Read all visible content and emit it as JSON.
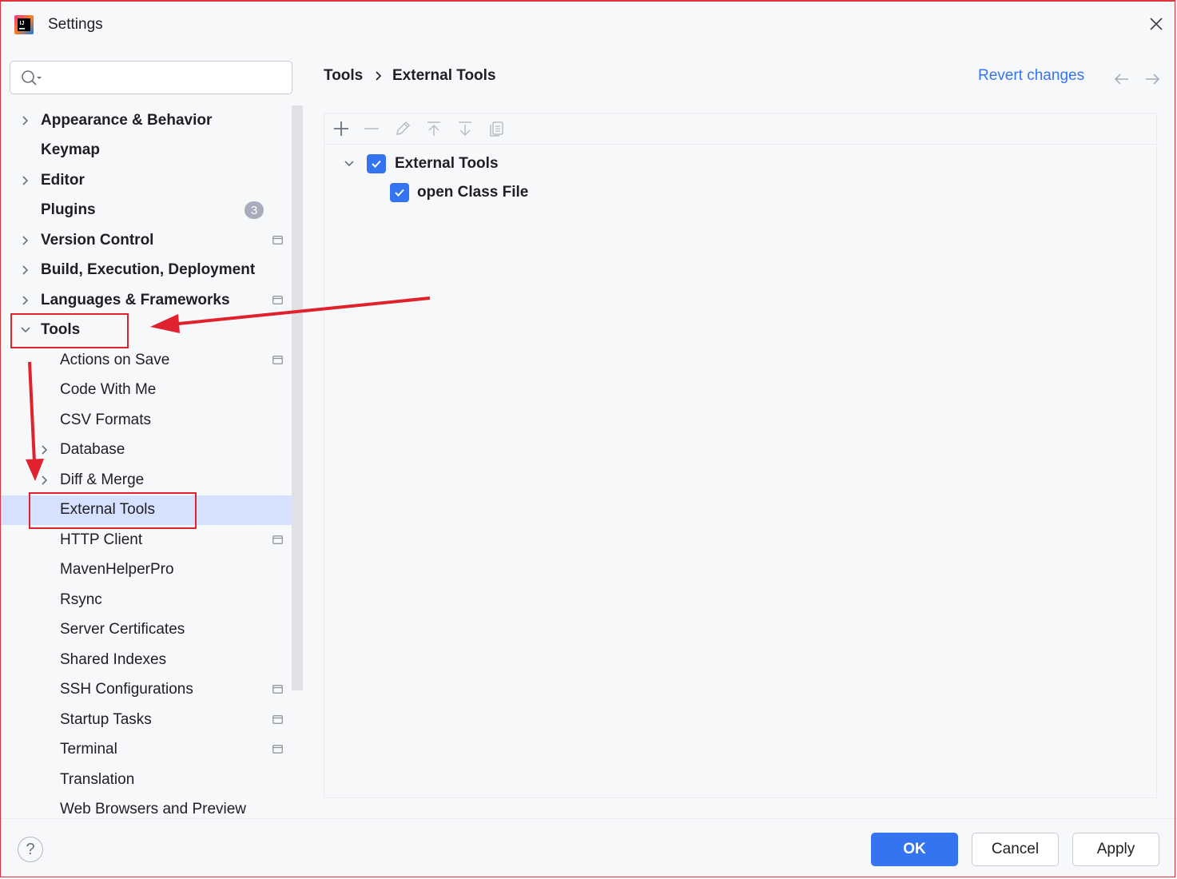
{
  "window": {
    "title": "Settings"
  },
  "search": {
    "placeholder": "",
    "value": ""
  },
  "sidebar": {
    "items": [
      {
        "label": "Appearance & Behavior",
        "level": 0,
        "bold": true,
        "expandable": true,
        "expanded": false
      },
      {
        "label": "Keymap",
        "level": 0,
        "bold": true,
        "expandable": false
      },
      {
        "label": "Editor",
        "level": 0,
        "bold": true,
        "expandable": true,
        "expanded": false
      },
      {
        "label": "Plugins",
        "level": 0,
        "bold": true,
        "expandable": false,
        "badge": "3"
      },
      {
        "label": "Version Control",
        "level": 0,
        "bold": true,
        "expandable": true,
        "expanded": false,
        "project_icon": true
      },
      {
        "label": "Build, Execution, Deployment",
        "level": 0,
        "bold": true,
        "expandable": true,
        "expanded": false
      },
      {
        "label": "Languages & Frameworks",
        "level": 0,
        "bold": true,
        "expandable": true,
        "expanded": false,
        "project_icon": true
      },
      {
        "label": "Tools",
        "level": 0,
        "bold": true,
        "expandable": true,
        "expanded": true
      },
      {
        "label": "Actions on Save",
        "level": 1,
        "project_icon": true
      },
      {
        "label": "Code With Me",
        "level": 1
      },
      {
        "label": "CSV Formats",
        "level": 1
      },
      {
        "label": "Database",
        "level": 1,
        "expandable": true,
        "expanded": false
      },
      {
        "label": "Diff & Merge",
        "level": 1,
        "expandable": true,
        "expanded": false
      },
      {
        "label": "External Tools",
        "level": 1,
        "selected": true
      },
      {
        "label": "HTTP Client",
        "level": 1,
        "project_icon": true
      },
      {
        "label": "MavenHelperPro",
        "level": 1
      },
      {
        "label": "Rsync",
        "level": 1
      },
      {
        "label": "Server Certificates",
        "level": 1
      },
      {
        "label": "Shared Indexes",
        "level": 1
      },
      {
        "label": "SSH Configurations",
        "level": 1,
        "project_icon": true
      },
      {
        "label": "Startup Tasks",
        "level": 1,
        "project_icon": true
      },
      {
        "label": "Terminal",
        "level": 1,
        "project_icon": true
      },
      {
        "label": "Translation",
        "level": 1
      },
      {
        "label": "Web Browsers and Preview",
        "level": 1
      }
    ]
  },
  "breadcrumb": {
    "parent": "Tools",
    "current": "External Tools"
  },
  "header": {
    "revert_label": "Revert changes"
  },
  "toolbar": {
    "icons": [
      "add-icon",
      "remove-icon",
      "edit-icon",
      "move-up-icon",
      "move-down-icon",
      "copy-icon"
    ]
  },
  "tools_tree": {
    "group": {
      "label": "External Tools",
      "checked": true,
      "expanded": true
    },
    "items": [
      {
        "label": "open Class File",
        "checked": true
      }
    ]
  },
  "footer": {
    "help_label": "?",
    "ok_label": "OK",
    "cancel_label": "Cancel",
    "apply_label": "Apply"
  },
  "colors": {
    "accent": "#3574f0",
    "selection": "#d5e1ff",
    "annotation": "#e0222e",
    "background": "#f7f8fa"
  }
}
